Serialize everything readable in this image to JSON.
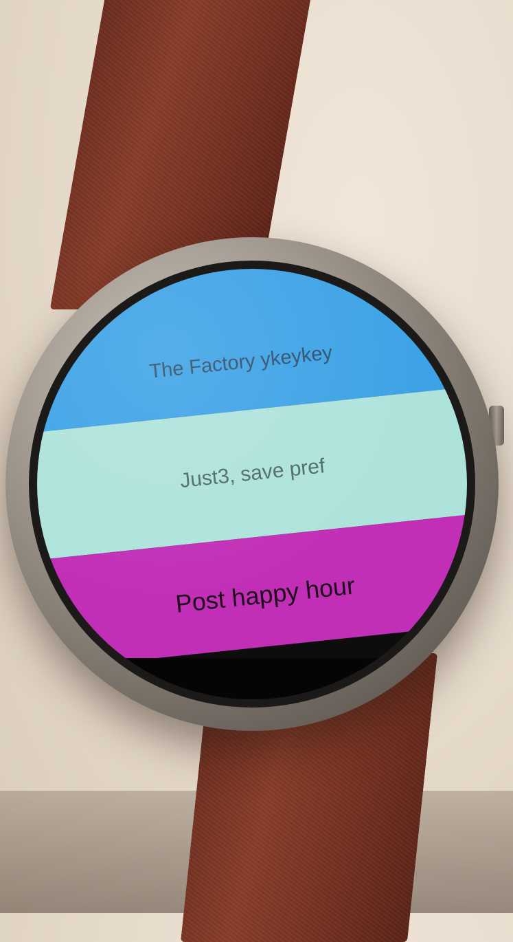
{
  "watch_screen": {
    "cards": [
      {
        "label": "The Factory ykeykey",
        "color": "#3ea3e6"
      },
      {
        "label": "Just3, save pref",
        "color": "#aee3dc"
      },
      {
        "label": "Post happy hour",
        "color": "#c12fb6"
      }
    ]
  }
}
